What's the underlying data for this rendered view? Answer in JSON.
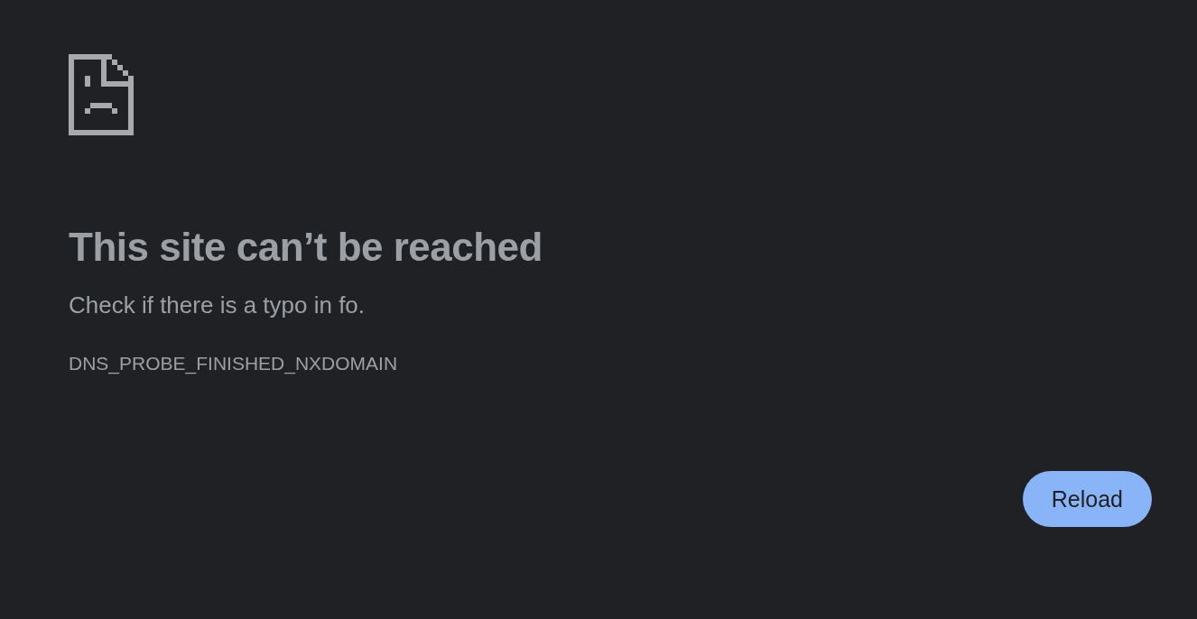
{
  "title": "This site can’t be reached",
  "message": "Check if there is a typo in fo.",
  "error_code": "DNS_PROBE_FINISHED_NXDOMAIN",
  "buttons": [
    "Reload"
  ]
}
